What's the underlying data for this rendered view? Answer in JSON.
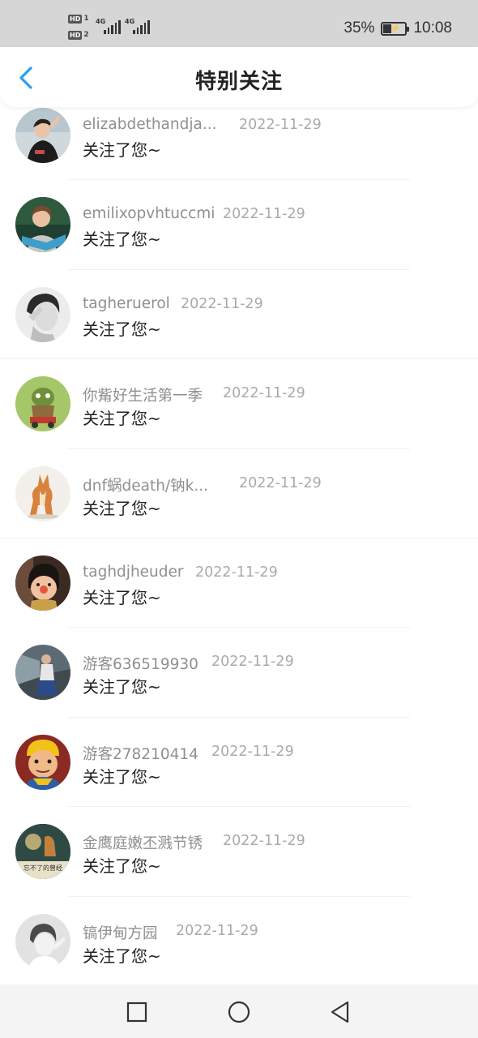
{
  "status_bar": {
    "sim1_badge": "HD",
    "sim1_num": "1",
    "sim2_badge": "HD",
    "sim2_num": "2",
    "net1": "4G",
    "net2": "4G",
    "battery_percent": "35%",
    "battery_level": 0.35,
    "time": "10:08"
  },
  "header": {
    "title": "特别关注",
    "back_icon": "chevron-left-icon",
    "accent_color": "#2d9cf0"
  },
  "items": [
    {
      "name": "elizabdethandja...",
      "date": "2022-11-29",
      "action": "关注了您~"
    },
    {
      "name": "emilixopvhtuccmi",
      "date": "2022-11-29",
      "action": "关注了您~"
    },
    {
      "name": "tagheruerol",
      "date": "2022-11-29",
      "action": "关注了您~"
    },
    {
      "name": "你觜好生活第一季",
      "date": "2022-11-29",
      "action": "关注了您~"
    },
    {
      "name": "dnf蜗death/钠k...",
      "date": "2022-11-29",
      "action": "关注了您~"
    },
    {
      "name": "taghdjheuder",
      "date": "2022-11-29",
      "action": "关注了您~"
    },
    {
      "name": "游客636519930",
      "date": "2022-11-29",
      "action": "关注了您~"
    },
    {
      "name": "游客278210414",
      "date": "2022-11-29",
      "action": "关注了您~"
    },
    {
      "name": "金鹰庭嫩丕溅节锈",
      "date": "2022-11-29",
      "action": "关注了您~",
      "avatar_caption": "忘不了的曾经"
    },
    {
      "name": "镐伊甸方园",
      "date": "2022-11-29",
      "action": "关注了您~"
    }
  ],
  "nav_bar": {
    "recent_icon": "square-icon",
    "home_icon": "circle-icon",
    "back_icon": "triangle-back-icon"
  }
}
